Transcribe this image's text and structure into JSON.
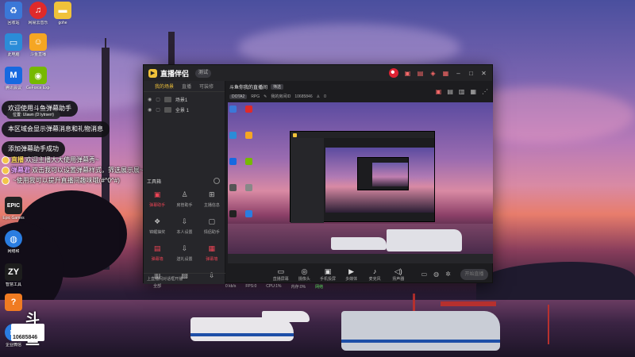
{
  "desktop": {
    "icons": [
      {
        "label": "回收站",
        "icon": "recycle-bin-icon",
        "color": "#3b78d8"
      },
      {
        "label": "网易云音乐",
        "icon": "netease-music-icon",
        "color": "#e02a2a"
      },
      {
        "label": "gohe",
        "icon": "folder-icon",
        "color": "#f0c23a"
      },
      {
        "label": "此电脑",
        "icon": "computer-icon",
        "color": "#2b8cd8"
      },
      {
        "label": "斗鱼直播",
        "icon": "douyu-icon",
        "color": "#f5a623"
      },
      {
        "label": "腾讯会议",
        "icon": "meeting-icon",
        "color": "#1769e0"
      },
      {
        "label": "GeForce Experience",
        "icon": "nvidia-icon",
        "color": "#76b900"
      },
      {
        "label": "Epic Games",
        "icon": "epic-games-icon",
        "color": "#222222"
      },
      {
        "label": "网络和",
        "icon": "network-icon",
        "color": "#2a7de1"
      },
      {
        "label": "智慧工具",
        "icon": "zy-icon",
        "color": "#1d1d1d"
      },
      {
        "label": "",
        "icon": "orange-app-icon",
        "color": "#f07b22"
      },
      {
        "label": "企业微信",
        "icon": "wecom-icon",
        "color": "#2a7de1"
      }
    ]
  },
  "overlay": {
    "bubbles": [
      "欢迎使用斗鱼弹幕助手",
      "本区域会显示弹幕消息和礼物消息",
      "添加弹幕助手成功"
    ],
    "tooltip": "位置: Ulawn (D:\\ytrserr)",
    "chat": [
      {
        "name": "直播",
        "text": "欢迎主播大大使用弹幕秀~"
      },
      {
        "name": "弹幕君",
        "text": "双击我可以设置弹幕样式，筛选展示展~"
      },
      {
        "name": "",
        "text": "~使用我可以提升直播间趣味哦(#^0^#)"
      }
    ]
  },
  "app": {
    "title": "直播伴侣",
    "version": "测试",
    "left_tabs": [
      "我的场景",
      "直播",
      "可装修"
    ],
    "scenes": [
      "场景1",
      "全景 1"
    ],
    "tools": [
      {
        "label": "弹幕助手",
        "icon": "danmaku-icon",
        "highlight": true
      },
      {
        "label": "房管助手",
        "icon": "admin-icon",
        "highlight": false
      },
      {
        "label": "主播信息",
        "icon": "anchor-info-icon",
        "highlight": false
      },
      {
        "label": "锦鲤抽奖",
        "icon": "lottery-icon",
        "highlight": false
      },
      {
        "label": "本人设置",
        "icon": "settings-icon",
        "highlight": false
      },
      {
        "label": "情侣助手",
        "icon": "couple-icon",
        "highlight": false
      },
      {
        "label": "弹幕墙",
        "icon": "danmaku-wall-icon",
        "highlight": true
      },
      {
        "label": "送礼设置",
        "icon": "gift-icon",
        "highlight": false
      },
      {
        "label": "弹幕墙",
        "icon": "wall2-icon",
        "highlight": true
      },
      {
        "label": "全部",
        "icon": "grid-icon",
        "highlight": false
      },
      {
        "label": "",
        "icon": "camera-icon",
        "highlight": false
      },
      {
        "label": "",
        "icon": "download-icon",
        "highlight": false
      }
    ],
    "tools_section_label": "工具箱",
    "left_bottom": "上直播间对话框开播",
    "room_title": "斗鱼你我的直播间",
    "room_tag": "筛选",
    "info": {
      "category": "DOTA2",
      "sub": "RPG",
      "room_label": "我的房间ID",
      "room_id": "10685846",
      "viewers": "0"
    },
    "bottom_actions": [
      {
        "label": "直播屏幕",
        "icon": "screen-icon"
      },
      {
        "label": "摄像头",
        "icon": "camera-icon"
      },
      {
        "label": "手机投屏",
        "icon": "phone-cast-icon"
      },
      {
        "label": "多媒体",
        "icon": "media-icon"
      },
      {
        "label": "麦克风",
        "icon": "mic-icon"
      },
      {
        "label": "扬声器",
        "icon": "speaker-icon"
      }
    ],
    "start_label": "开始直播",
    "status": {
      "bitrate": "0 kb/s",
      "fps": "FPS:0",
      "cpu": "CPU:1%",
      "mem": "内存:0%",
      "net": "网络"
    }
  },
  "widget": {
    "name": "斗鱼",
    "id": "10685846"
  }
}
